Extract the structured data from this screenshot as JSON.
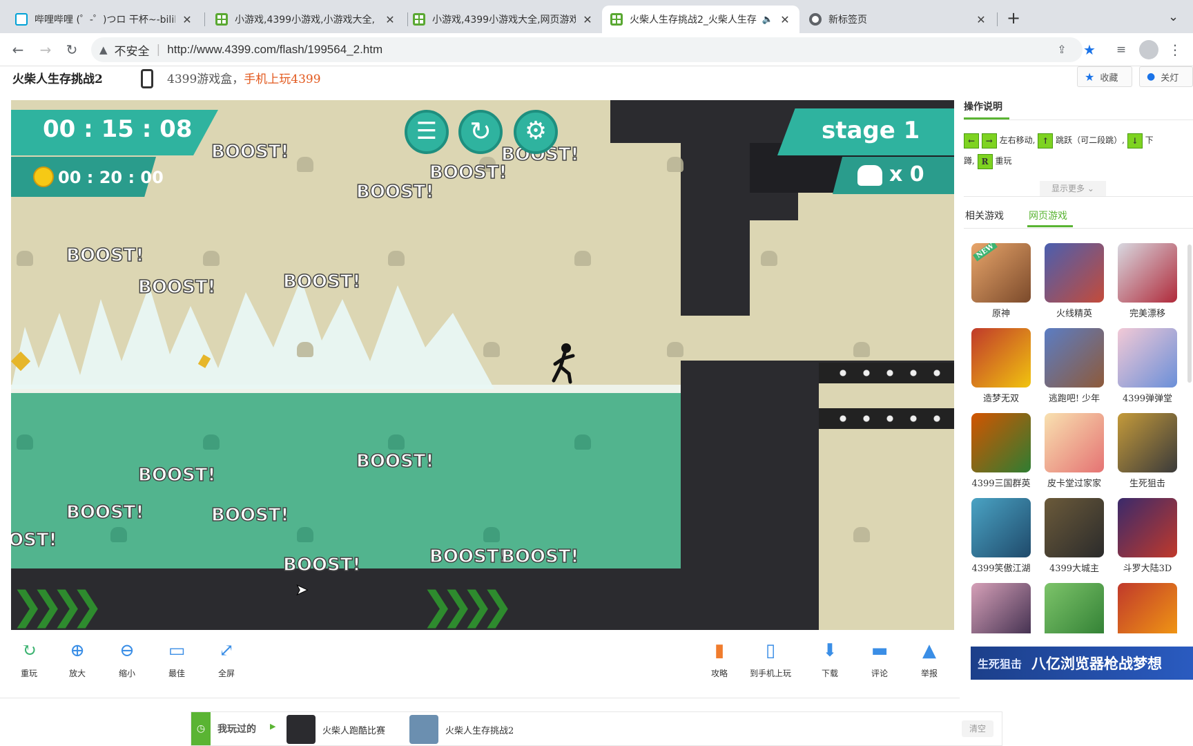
{
  "browser": {
    "tabs": [
      {
        "title": "哔哩哔哩 (゜-゜)つロ 干杯~-bilil",
        "close": "✕"
      },
      {
        "title": "小游戏,4399小游戏,小游戏大全,",
        "close": "✕"
      },
      {
        "title": "小游戏,4399小游戏大全,网页游戏",
        "close": "✕"
      },
      {
        "title": "火柴人生存挑战2_火柴人生存",
        "close": "✕",
        "audio": "🔈"
      },
      {
        "title": "新标签页",
        "close": "✕"
      }
    ],
    "new_tab": "+",
    "tab_menu": "⌄",
    "security_label": "不安全",
    "url": "http://www.4399.com/flash/199564_2.htm"
  },
  "header": {
    "game_title": "火柴人生存挑战2",
    "promo_prefix": "4399游戏盒，",
    "promo_link": "手机上玩4399",
    "favorite_label": "收藏",
    "lights_label": "关灯"
  },
  "game": {
    "timer": "00 : 15 : 08",
    "coin_timer": "00 : 20 : 00",
    "stage": "stage 1",
    "death_count": "x 0",
    "boost_text": "BOOST!",
    "boosts_top": [
      "BOOST!",
      "BOOST!",
      "BOOST!",
      "BOOST!",
      "BOOST!",
      "BOOST!",
      "BOOST!"
    ],
    "boosts_water": [
      "BOOST!",
      "BOOST!",
      "BOOST!",
      "BOOST!",
      "OST!",
      "BOOST!",
      "BOOST!",
      "BOOST!"
    ]
  },
  "tools_left": [
    {
      "label": "重玩",
      "icon": "refresh-icon",
      "color": "#3cb371"
    },
    {
      "label": "放大",
      "icon": "zoom-in-icon",
      "color": "#3a8ee6"
    },
    {
      "label": "缩小",
      "icon": "zoom-out-icon",
      "color": "#3a8ee6"
    },
    {
      "label": "最佳",
      "icon": "window-icon",
      "color": "#3a8ee6"
    },
    {
      "label": "全屏",
      "icon": "fullscreen-icon",
      "color": "#3a8ee6"
    }
  ],
  "tools_right": [
    {
      "label": "攻略",
      "icon": "book-icon",
      "color": "#f07c2d"
    },
    {
      "label": "到手机上玩",
      "icon": "phone-icon",
      "color": "#3a8ee6"
    },
    {
      "label": "下载",
      "icon": "download-icon",
      "color": "#3a8ee6"
    },
    {
      "label": "评论",
      "icon": "comment-icon",
      "color": "#3a8ee6"
    },
    {
      "label": "举报",
      "icon": "warning-icon",
      "color": "#3a8ee6"
    }
  ],
  "sidebar": {
    "instructions_title": "操作说明",
    "move_text": "左右移动,",
    "jump_text": "跳跃（可二段跳）,",
    "down_text": "下",
    "crouch_text": "蹲,",
    "replay_key": "R",
    "replay_text": "重玩",
    "show_more": "显示更多",
    "tab_related": "相关游戏",
    "tab_web": "网页游戏",
    "games": [
      {
        "name": "原神",
        "badge": "NEW",
        "color1": "#e8a56a",
        "color2": "#7b4a2b"
      },
      {
        "name": "火线精英",
        "color1": "#4a5fb0",
        "color2": "#c44b3a"
      },
      {
        "name": "完美漂移",
        "color1": "#d8d8e0",
        "color2": "#b02a3a"
      },
      {
        "name": "造梦无双",
        "color1": "#c0392b",
        "color2": "#f1c40f"
      },
      {
        "name": "逃跑吧! 少年",
        "color1": "#5b7dc4",
        "color2": "#8e5a3a"
      },
      {
        "name": "4399弹弹堂",
        "color1": "#f2c9d6",
        "color2": "#6a8fd8"
      },
      {
        "name": "4399三国群英",
        "color1": "#d35400",
        "color2": "#2e7d32"
      },
      {
        "name": "皮卡堂过家家",
        "color1": "#f8e1b0",
        "color2": "#e57373"
      },
      {
        "name": "生死狙击",
        "color1": "#c49a3a",
        "color2": "#3a3a3a"
      },
      {
        "name": "4399笑傲江湖",
        "color1": "#4aa3c4",
        "color2": "#1f4a6b"
      },
      {
        "name": "4399大城主",
        "color1": "#6b5a3a",
        "color2": "#2b2b2b"
      },
      {
        "name": "斗罗大陆3D",
        "color1": "#3a2a6b",
        "color2": "#c0392b"
      },
      {
        "name": "",
        "color1": "#d6a0b8",
        "color2": "#3a2a4a"
      },
      {
        "name": "",
        "color1": "#7dc46a",
        "color2": "#2e7d32"
      },
      {
        "name": "",
        "color1": "#c0392b",
        "color2": "#f39c12"
      }
    ],
    "banner_left": "生死狙击",
    "banner_right": "八亿浏览器枪战梦想"
  },
  "recent": {
    "label": "我玩过的",
    "games": [
      "火柴人跑酷比赛",
      "火柴人生存挑战2"
    ],
    "clear": "清空"
  }
}
